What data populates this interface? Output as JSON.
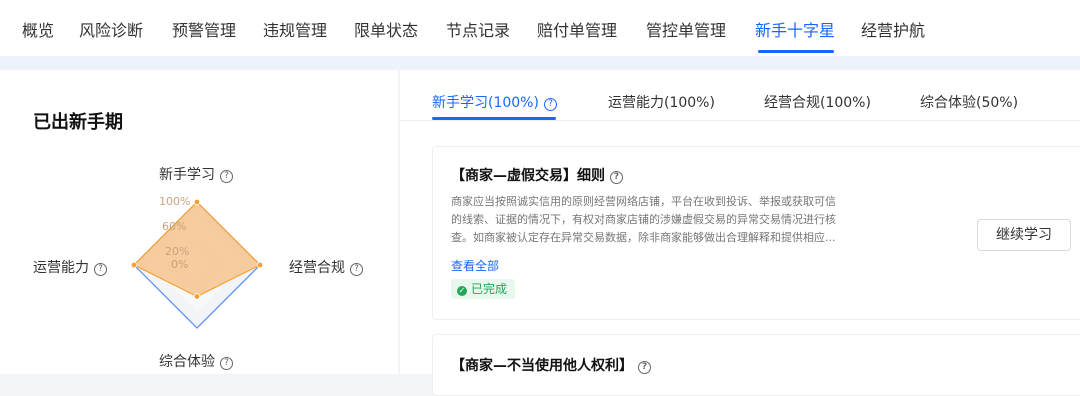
{
  "nav": {
    "items": [
      {
        "label": "概览"
      },
      {
        "label": "风险诊断"
      },
      {
        "label": "预警管理"
      },
      {
        "label": "违规管理"
      },
      {
        "label": "限单状态"
      },
      {
        "label": "节点记录"
      },
      {
        "label": "赔付单管理"
      },
      {
        "label": "管控单管理"
      },
      {
        "label": "新手十字星",
        "active": true
      },
      {
        "label": "经营护航"
      }
    ]
  },
  "left": {
    "title": "已出新手期",
    "radar": {
      "axes": [
        "新手学习",
        "经营合规",
        "综合体验",
        "运营能力"
      ],
      "values_percent": [
        100,
        100,
        50,
        100
      ],
      "tick_labels": [
        "100%",
        "60%",
        "20%",
        "0%"
      ],
      "fill_color": "#f7c48e",
      "stroke_color": "#f5a031",
      "outer_color": "#5b8def"
    }
  },
  "tabs": [
    {
      "label": "新手学习(100%)",
      "active": true,
      "has_help": true
    },
    {
      "label": "运营能力(100%)"
    },
    {
      "label": "经营合规(100%)"
    },
    {
      "label": "综合体验(50%)"
    }
  ],
  "item1": {
    "title": "【商家—虚假交易】细则",
    "desc_lines": [
      "商家应当按照诚实信用的原则经营网络店铺，平台在收到投诉、举报或获取可信",
      "的线索、证据的情况下，有权对商家店铺的涉嫌虚假交易的异常交易情况进行核",
      "查。如商家被认定存在异常交易数据，除非商家能够做出合理解释和提供相应..."
    ],
    "view_all": "查看全部",
    "status": "已完成",
    "button": "继续学习"
  },
  "item2": {
    "title": "【商家—不当使用他人权利】"
  },
  "colors": {
    "accent": "#1966ff",
    "success": "#22a657"
  }
}
